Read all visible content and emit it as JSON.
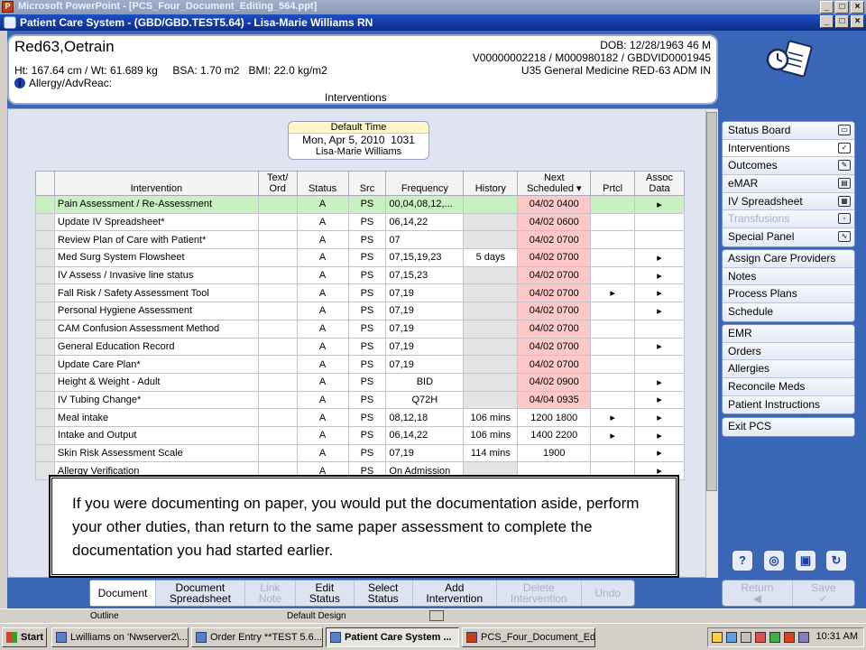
{
  "ppt_window": {
    "title": "Microsoft PowerPoint - [PCS_Four_Document_Editing_564.ppt]",
    "status_left": "Outline",
    "status_center": "Default Design"
  },
  "app_window": {
    "title": "Patient Care System - (GBD/GBD.TEST5.64) - Lisa-Marie Williams RN"
  },
  "patient": {
    "name": "Red63,Oetrain",
    "vitals": "Ht: 167.64 cm / Wt: 61.689 kg     BSA: 1.70 m2   BMI: 22.0 kg/m2",
    "allergy_label": "Allergy/AdvReac:",
    "dob": "DOB: 12/28/1963 46 M",
    "ids": "V00000002218 / M000980182 / GBDVID0001945",
    "unit": "U35 General Medicine  RED-63  ADM IN",
    "section": "Interventions"
  },
  "default_time": {
    "title": "Default Time",
    "date": "Mon, Apr 5, 2010  1031",
    "user": "Lisa-Marie Williams"
  },
  "table": {
    "headers": {
      "intervention": "Intervention",
      "text_ord_1": "Text/",
      "text_ord_2": "Ord",
      "status": "Status",
      "src": "Src",
      "frequency": "Frequency",
      "history": "History",
      "next_1": "Next",
      "next_2": "Scheduled ▾",
      "prtcl": "Prtcl",
      "assoc_1": "Assoc",
      "assoc_2": "Data"
    },
    "rows": [
      {
        "intervention": "Pain Assessment / Re-Assessment",
        "status": "A",
        "src": "PS",
        "frequency": "00,04,08,12,...",
        "history": "",
        "next": "04/02 0400",
        "prtcl": "",
        "assoc": "▸",
        "late": true
      },
      {
        "intervention": "Update IV Spreadsheet*",
        "status": "A",
        "src": "PS",
        "frequency": "06,14,22",
        "history": "",
        "next": "04/02 0600",
        "prtcl": "",
        "assoc": "",
        "late": true
      },
      {
        "intervention": "Review Plan of Care with Patient*",
        "status": "A",
        "src": "PS",
        "frequency": "07",
        "history": "",
        "next": "04/02 0700",
        "prtcl": "",
        "assoc": "",
        "late": true
      },
      {
        "intervention": "Med Surg System Flowsheet",
        "status": "A",
        "src": "PS",
        "frequency": "07,15,19,23",
        "history": "5 days",
        "next": "04/02 0700",
        "prtcl": "",
        "assoc": "▸",
        "late": true
      },
      {
        "intervention": "IV Assess / Invasive line status",
        "status": "A",
        "src": "PS",
        "frequency": "07,15,23",
        "history": "",
        "next": "04/02 0700",
        "prtcl": "",
        "assoc": "▸",
        "late": true
      },
      {
        "intervention": "Fall Risk / Safety Assessment Tool",
        "status": "A",
        "src": "PS",
        "frequency": "07,19",
        "history": "",
        "next": "04/02 0700",
        "prtcl": "▸",
        "assoc": "▸",
        "late": true
      },
      {
        "intervention": "Personal Hygiene Assessment",
        "status": "A",
        "src": "PS",
        "frequency": "07,19",
        "history": "",
        "next": "04/02 0700",
        "prtcl": "",
        "assoc": "▸",
        "late": true
      },
      {
        "intervention": "CAM Confusion Assessment Method",
        "status": "A",
        "src": "PS",
        "frequency": "07,19",
        "history": "",
        "next": "04/02 0700",
        "prtcl": "",
        "assoc": "",
        "late": true
      },
      {
        "intervention": "General Education Record",
        "status": "A",
        "src": "PS",
        "frequency": "07,19",
        "history": "",
        "next": "04/02 0700",
        "prtcl": "",
        "assoc": "▸",
        "late": true
      },
      {
        "intervention": "Update Care Plan*",
        "status": "A",
        "src": "PS",
        "frequency": "07,19",
        "history": "",
        "next": "04/02 0700",
        "prtcl": "",
        "assoc": "",
        "late": true
      },
      {
        "intervention": "Height & Weight - Adult",
        "status": "A",
        "src": "PS",
        "frequency": "BID",
        "history": "",
        "next": "04/02 0900",
        "prtcl": "",
        "assoc": "▸",
        "late": true
      },
      {
        "intervention": "IV Tubing Change*",
        "status": "A",
        "src": "PS",
        "frequency": "Q72H",
        "history": "",
        "next": "04/04 0935",
        "prtcl": "",
        "assoc": "▸",
        "late": true
      },
      {
        "intervention": "Meal intake",
        "status": "A",
        "src": "PS",
        "frequency": "08,12,18",
        "history": "106 mins",
        "next": "1200 1800",
        "prtcl": "▸",
        "assoc": "▸",
        "late": false
      },
      {
        "intervention": "Intake and Output",
        "status": "A",
        "src": "PS",
        "frequency": "06,14,22",
        "history": "106 mins",
        "next": "1400 2200",
        "prtcl": "▸",
        "assoc": "▸",
        "late": false
      },
      {
        "intervention": "Skin Risk Assessment Scale",
        "status": "A",
        "src": "PS",
        "frequency": "07,19",
        "history": "114 mins",
        "next": "1900",
        "prtcl": "",
        "assoc": "▸",
        "late": false
      },
      {
        "intervention": "Allergy Verification",
        "status": "A",
        "src": "PS",
        "frequency": "On Admission",
        "history": "",
        "next": "",
        "prtcl": "",
        "assoc": "▸",
        "late": false
      }
    ]
  },
  "callout": {
    "text": "If you were documenting on paper, you would put the documentation aside, perform your other duties, than return to the same paper assessment to complete the documentation you had started earlier."
  },
  "nav": {
    "group1": [
      "Status Board",
      "Interventions",
      "Outcomes",
      "eMAR",
      "IV Spreadsheet",
      "Transfusions",
      "Special Panel"
    ],
    "group2": [
      "Assign Care Providers",
      "Notes",
      "Process Plans",
      "Schedule"
    ],
    "group3": [
      "EMR",
      "Orders",
      "Allergies",
      "Reconcile Meds",
      "Patient Instructions"
    ],
    "group4": [
      "Exit PCS"
    ]
  },
  "toolbar": {
    "document": "Document",
    "doc_spread_1": "Document",
    "doc_spread_2": "Spreadsheet",
    "link_1": "Link",
    "link_2": "Note",
    "edit_1": "Edit",
    "edit_2": "Status",
    "select_1": "Select",
    "select_2": "Status",
    "add_1": "Add",
    "add_2": "Intervention",
    "delete_1": "Delete",
    "delete_2": "Intervention",
    "undo": "Undo",
    "return": "Return",
    "save": "Save"
  },
  "taskbar": {
    "start": "Start",
    "task1": "Lwilliams on 'Nwserver2\\...",
    "task2": "Order Entry **TEST 5.6...",
    "task3": "Patient Care System ...",
    "task4": "PCS_Four_Document_Ed...",
    "clock": "10:31 AM"
  }
}
